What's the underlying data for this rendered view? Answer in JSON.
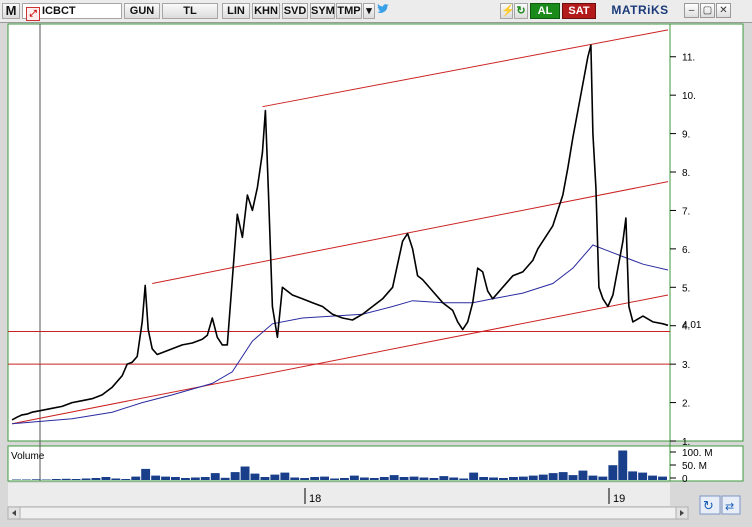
{
  "toolbar": {
    "logo": "M",
    "symbol": "ICBCT",
    "buttons": [
      "GUN",
      "TL",
      "LIN",
      "KHN",
      "SVD",
      "SYM",
      "TMP"
    ],
    "buy_label": "AL",
    "sell_label": "SAT",
    "brand": "MATRiKS",
    "colors": {
      "buy": "#1a8a1a",
      "sell": "#b31b1b",
      "brand": "#1d3b7a"
    },
    "icons": [
      "dropdown-arrow-icon",
      "twitter-icon",
      "lightning-icon",
      "refresh-icon",
      "minimize-icon",
      "restore-icon",
      "close-icon"
    ]
  },
  "price_axis": {
    "ticks": [
      "11.",
      "10.",
      "9.",
      "8.",
      "7.",
      "6.",
      "5.",
      "4.",
      "3.",
      "2.",
      "1."
    ],
    "current_price": "4.01"
  },
  "volume_panel": {
    "label": "Volume",
    "ticks": [
      "100. M",
      "50. M",
      "0"
    ]
  },
  "time_axis": {
    "labels": [
      "18",
      "19"
    ]
  },
  "chart_data": {
    "type": "line",
    "title": "",
    "ylim": [
      1,
      11.8
    ],
    "grid": false,
    "price": {
      "color": "#000000",
      "points": [
        [
          0,
          1.55
        ],
        [
          0.5,
          1.62
        ],
        [
          1,
          1.68
        ],
        [
          1.5,
          1.7
        ],
        [
          2,
          1.75
        ],
        [
          3,
          1.8
        ],
        [
          4,
          1.85
        ],
        [
          5,
          1.9
        ],
        [
          6,
          2.0
        ],
        [
          7,
          2.05
        ],
        [
          8,
          2.1
        ],
        [
          9,
          2.2
        ],
        [
          10,
          2.4
        ],
        [
          11,
          2.7
        ],
        [
          11.5,
          3.0
        ],
        [
          12,
          3.05
        ],
        [
          12.5,
          3.2
        ],
        [
          13,
          4.1
        ],
        [
          13.3,
          5.05
        ],
        [
          13.6,
          3.9
        ],
        [
          14,
          3.4
        ],
        [
          14.5,
          3.25
        ],
        [
          15,
          3.3
        ],
        [
          16,
          3.4
        ],
        [
          17,
          3.5
        ],
        [
          18,
          3.55
        ],
        [
          19,
          3.65
        ],
        [
          19.5,
          3.75
        ],
        [
          20,
          4.2
        ],
        [
          20.5,
          3.7
        ],
        [
          21,
          3.5
        ],
        [
          21.5,
          3.5
        ],
        [
          22,
          5.2
        ],
        [
          22.5,
          6.9
        ],
        [
          23,
          6.3
        ],
        [
          23.5,
          7.4
        ],
        [
          24,
          7.0
        ],
        [
          24.5,
          7.6
        ],
        [
          25,
          8.5
        ],
        [
          25.3,
          9.6
        ],
        [
          25.6,
          7.5
        ],
        [
          26,
          4.5
        ],
        [
          26.5,
          3.7
        ],
        [
          27,
          5.0
        ],
        [
          28,
          4.8
        ],
        [
          29,
          4.7
        ],
        [
          30,
          4.6
        ],
        [
          31,
          4.5
        ],
        [
          32,
          4.3
        ],
        [
          33,
          4.2
        ],
        [
          34,
          4.15
        ],
        [
          35,
          4.3
        ],
        [
          36,
          4.5
        ],
        [
          37,
          4.7
        ],
        [
          38,
          5.0
        ],
        [
          38.5,
          5.6
        ],
        [
          39,
          6.2
        ],
        [
          39.5,
          6.4
        ],
        [
          40,
          6.0
        ],
        [
          40.5,
          5.3
        ],
        [
          41,
          5.2
        ],
        [
          42,
          4.9
        ],
        [
          43,
          4.6
        ],
        [
          44,
          4.4
        ],
        [
          44.5,
          4.1
        ],
        [
          45,
          3.9
        ],
        [
          45.5,
          4.1
        ],
        [
          46,
          4.6
        ],
        [
          46.5,
          5.5
        ],
        [
          47,
          5.4
        ],
        [
          47.5,
          4.9
        ],
        [
          48,
          4.7
        ],
        [
          49,
          5.0
        ],
        [
          50,
          5.3
        ],
        [
          51,
          5.4
        ],
        [
          52,
          5.7
        ],
        [
          52.5,
          6.0
        ],
        [
          53,
          6.2
        ],
        [
          54,
          6.6
        ],
        [
          54.5,
          7.0
        ],
        [
          55,
          7.4
        ],
        [
          55.5,
          8.1
        ],
        [
          56,
          8.9
        ],
        [
          56.5,
          9.6
        ],
        [
          57,
          10.3
        ],
        [
          57.5,
          11.0
        ],
        [
          57.8,
          11.3
        ],
        [
          58,
          9.0
        ],
        [
          58.3,
          7.6
        ],
        [
          58.6,
          5.0
        ],
        [
          59,
          4.7
        ],
        [
          59.5,
          4.5
        ],
        [
          60,
          4.8
        ],
        [
          60.5,
          5.5
        ],
        [
          61,
          6.2
        ],
        [
          61.3,
          6.8
        ],
        [
          61.6,
          4.5
        ],
        [
          62,
          4.1
        ],
        [
          63,
          4.25
        ],
        [
          64,
          4.1
        ],
        [
          65,
          4.05
        ],
        [
          65.5,
          4.01
        ]
      ]
    },
    "moving_average": {
      "color": "#2a2aa0",
      "points": [
        [
          0,
          1.45
        ],
        [
          6,
          1.58
        ],
        [
          10,
          1.75
        ],
        [
          13,
          2.0
        ],
        [
          16,
          2.2
        ],
        [
          20,
          2.5
        ],
        [
          22,
          2.8
        ],
        [
          24,
          3.6
        ],
        [
          26,
          4.05
        ],
        [
          29,
          4.2
        ],
        [
          32,
          4.25
        ],
        [
          35,
          4.3
        ],
        [
          38,
          4.5
        ],
        [
          40,
          4.65
        ],
        [
          43,
          4.6
        ],
        [
          46,
          4.6
        ],
        [
          48,
          4.7
        ],
        [
          51,
          4.85
        ],
        [
          54,
          5.1
        ],
        [
          56,
          5.5
        ],
        [
          58,
          6.1
        ],
        [
          59.5,
          5.95
        ],
        [
          61,
          5.8
        ],
        [
          63,
          5.6
        ],
        [
          65.5,
          5.45
        ]
      ]
    },
    "trend_channel": {
      "color": "#cc2222",
      "lines": [
        {
          "from": [
            0,
            1.45
          ],
          "to": [
            65.5,
            4.8
          ]
        },
        {
          "from": [
            14,
            5.1
          ],
          "to": [
            65.5,
            7.75
          ]
        },
        {
          "from": [
            25,
            9.7
          ],
          "to": [
            65.5,
            11.7
          ]
        }
      ]
    },
    "horizontal_lines": {
      "color": "#cc2222",
      "values": [
        3.85,
        3.0
      ]
    },
    "volume": {
      "ylim": [
        0,
        130
      ],
      "values": [
        2,
        2,
        3,
        2,
        4,
        5,
        4,
        6,
        8,
        12,
        6,
        4,
        14,
        45,
        18,
        14,
        12,
        8,
        10,
        12,
        28,
        9,
        32,
        55,
        26,
        12,
        22,
        30,
        10,
        8,
        12,
        14,
        6,
        8,
        18,
        10,
        8,
        12,
        20,
        12,
        14,
        10,
        8,
        16,
        10,
        6,
        30,
        12,
        10,
        8,
        12,
        14,
        18,
        22,
        28,
        32,
        20,
        38,
        18,
        14,
        60,
        120,
        35,
        30,
        18,
        14
      ]
    }
  }
}
